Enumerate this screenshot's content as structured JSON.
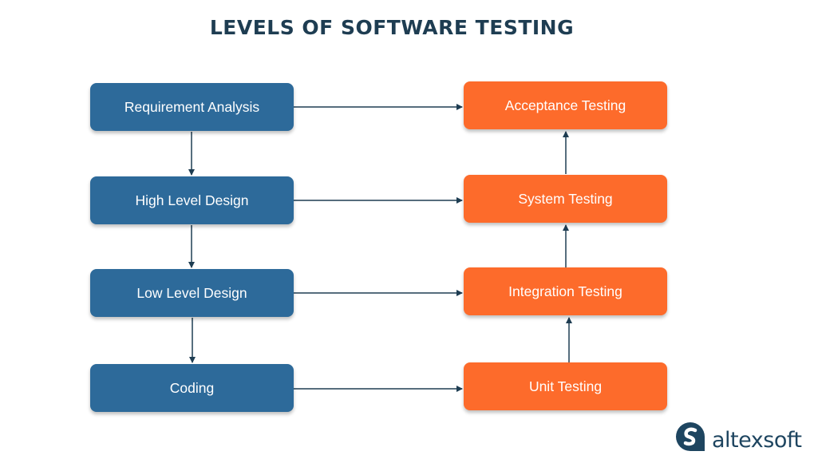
{
  "title": "LEVELS OF SOFTWARE TESTING",
  "colors": {
    "development": "#2d6a9a",
    "testing": "#fd6b2b",
    "arrow": "#1e3d52",
    "title": "#1e3d52"
  },
  "development_stages": [
    {
      "label": "Requirement Analysis"
    },
    {
      "label": "High Level Design"
    },
    {
      "label": "Low Level Design"
    },
    {
      "label": "Coding"
    }
  ],
  "testing_stages": [
    {
      "label": "Acceptance Testing"
    },
    {
      "label": "System Testing"
    },
    {
      "label": "Integration Testing"
    },
    {
      "label": "Unit Testing"
    }
  ],
  "edges": [
    {
      "from": "Requirement Analysis",
      "to": "High Level Design"
    },
    {
      "from": "High Level Design",
      "to": "Low Level Design"
    },
    {
      "from": "Low Level Design",
      "to": "Coding"
    },
    {
      "from": "Requirement Analysis",
      "to": "Acceptance Testing"
    },
    {
      "from": "High Level Design",
      "to": "System Testing"
    },
    {
      "from": "Low Level Design",
      "to": "Integration Testing"
    },
    {
      "from": "Coding",
      "to": "Unit Testing"
    },
    {
      "from": "Unit Testing",
      "to": "Integration Testing"
    },
    {
      "from": "Integration Testing",
      "to": "System Testing"
    },
    {
      "from": "System Testing",
      "to": "Acceptance Testing"
    }
  ],
  "logo": {
    "text": "altexsoft",
    "icon": "altexsoft-logo-icon"
  }
}
